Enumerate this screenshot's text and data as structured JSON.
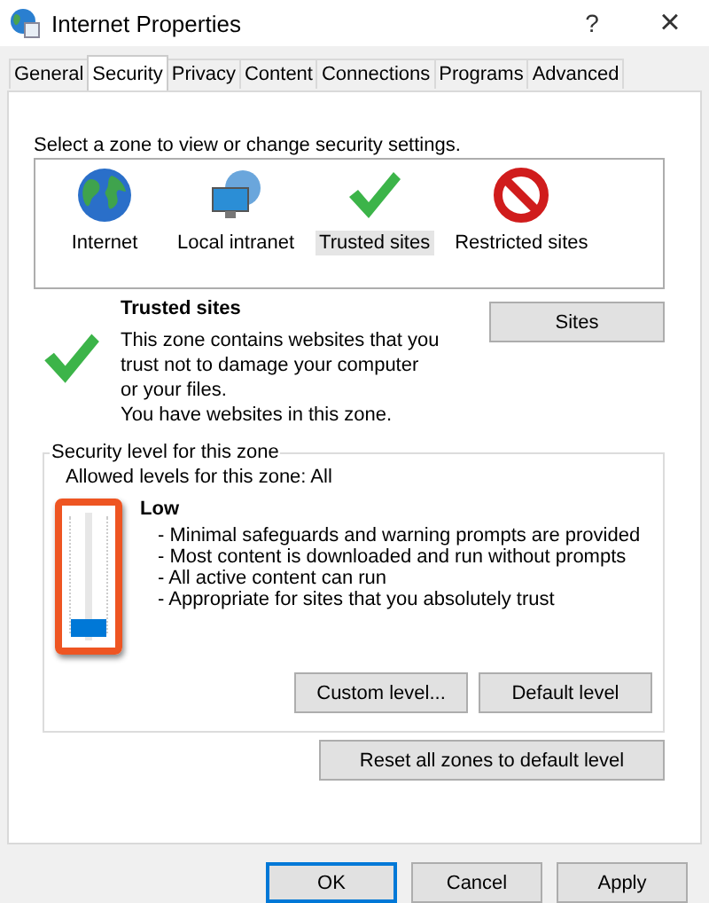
{
  "window": {
    "title": "Internet Properties",
    "help": "?",
    "close": "×"
  },
  "tabs": [
    {
      "label": "General",
      "selected": false
    },
    {
      "label": "Security",
      "selected": true
    },
    {
      "label": "Privacy",
      "selected": false
    },
    {
      "label": "Content",
      "selected": false
    },
    {
      "label": "Connections",
      "selected": false
    },
    {
      "label": "Programs",
      "selected": false
    },
    {
      "label": "Advanced",
      "selected": false
    }
  ],
  "zone_prompt": "Select a zone to view or change security settings.",
  "zones": [
    {
      "label": "Internet",
      "kind": "globe",
      "selected": false
    },
    {
      "label": "Local intranet",
      "kind": "network",
      "selected": false
    },
    {
      "label": "Trusted sites",
      "kind": "check",
      "selected": true
    },
    {
      "label": "Restricted sites",
      "kind": "restricted",
      "selected": false
    }
  ],
  "zone_info": {
    "kind": "check",
    "title": "Trusted sites",
    "description": "This zone contains websites that you trust not to damage your computer or your files.",
    "note": "You have websites in this zone.",
    "button": "Sites"
  },
  "security_level": {
    "legend": "Security level for this zone",
    "allowed": "Allowed levels for this zone: All",
    "highlighted": true,
    "level": 0,
    "name": "Low",
    "points": [
      "- Minimal safeguards and warning prompts are provided",
      "- Most content is downloaded and run without prompts",
      "- All active content can run",
      "- Appropriate for sites that you absolutely trust"
    ],
    "buttons": [
      "Custom level...",
      "Default level"
    ]
  },
  "reset_button": "Reset all zones to default level",
  "buttons": [
    {
      "label": "OK",
      "default": true
    },
    {
      "label": "Cancel",
      "default": false
    },
    {
      "label": "Apply",
      "default": false
    }
  ]
}
